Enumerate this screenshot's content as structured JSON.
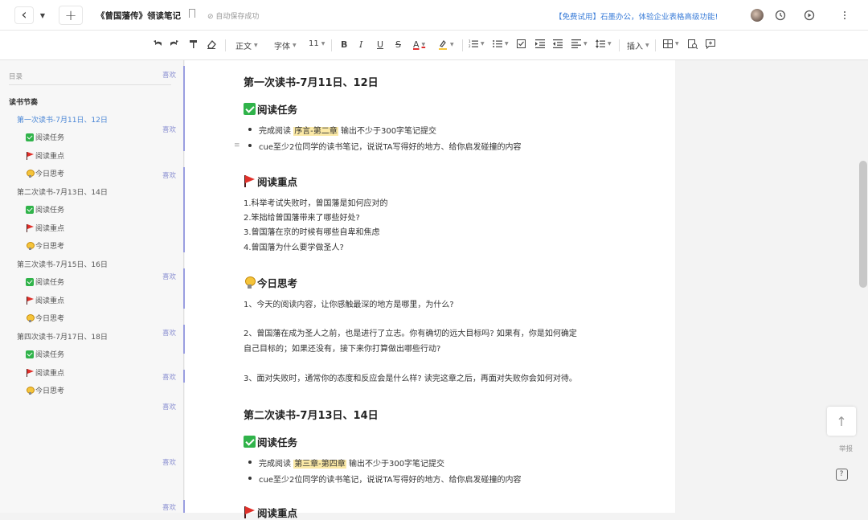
{
  "header": {
    "back_icon": "‹",
    "dropdown_icon": "▼",
    "new_icon": "+",
    "title": "《曾国藩传》领读笔记",
    "save_status": "自动保存成功",
    "promo": "【免费试用】石墨办公，体验企业表格高级功能!",
    "history_icon": "history-icon",
    "present_icon": "play-icon",
    "more_icon": "more-icon"
  },
  "toolbar": {
    "style": "正文",
    "font": "字体",
    "size": "11",
    "bold": "B",
    "italic": "I",
    "underline": "U",
    "strike": "S",
    "color": "A",
    "insert": "插入"
  },
  "sidebar": {
    "heading": "目录",
    "items": [
      {
        "label": "读书节奏"
      },
      {
        "label": "第一次读书-7月11日、12日"
      },
      {
        "label": "阅读任务"
      },
      {
        "label": "阅读重点"
      },
      {
        "label": "今日思考"
      },
      {
        "label": "第二次读书-7月13日、14日"
      },
      {
        "label": "阅读任务"
      },
      {
        "label": "阅读重点"
      },
      {
        "label": "今日思考"
      },
      {
        "label": "第三次读书-7月15日、16日"
      },
      {
        "label": "阅读任务"
      },
      {
        "label": "阅读重点"
      },
      {
        "label": "今日思考"
      },
      {
        "label": "第四次读书-7月17日、18日"
      },
      {
        "label": "阅读任务"
      },
      {
        "label": "阅读重点"
      },
      {
        "label": "今日思考"
      }
    ],
    "like_label": "喜欢"
  },
  "doc": {
    "sec1_title": "第一次读书-7月11日、12日",
    "task_heading": "阅读任务",
    "task1_pre": "完成阅读 ",
    "task1_hl": "序言-第二章",
    "task1_post": " 输出不少于300字笔记提交",
    "task2": "cue至少2位同学的读书笔记，说说TA写得好的地方、给你启发碰撞的内容",
    "key_heading": "阅读重点",
    "key1": "1.科举考试失败时，曾国藩是如何应对的",
    "key2": "2.笨拙给曾国藩带来了哪些好处?",
    "key3": "3.曾国藩在京的时候有哪些自卑和焦虑",
    "key4": "4.曾国藩为什么要学做圣人?",
    "think_heading": "今日思考",
    "think1": "1、今天的阅读内容，让你感触最深的地方是哪里，为什么?",
    "think2a": "2、曾国藩在成为圣人之前，也是进行了立志。你有确切的远大目标吗? 如果有，你是如何确定",
    "think2b": "自己目标的；如果还没有，接下来你打算做出哪些行动?",
    "think3": "3、面对失败时，通常你的态度和反应会是什么样? 读完这章之后，再面对失败你会如何对待。",
    "sec2_title": "第二次读书-7月13日、14日",
    "task2_1_pre": "完成阅读 ",
    "task2_1_hl": "第三章-第四章",
    "task2_1_post": " 输出不少于300字笔记提交",
    "task2_2": "cue至少2位同学的读书笔记，说说TA写得好的地方、给你启发碰撞的内容",
    "key_heading_partial": "阅读重点"
  },
  "floats": {
    "top_icon": "↑",
    "report": "举报",
    "help_icon": "?"
  }
}
